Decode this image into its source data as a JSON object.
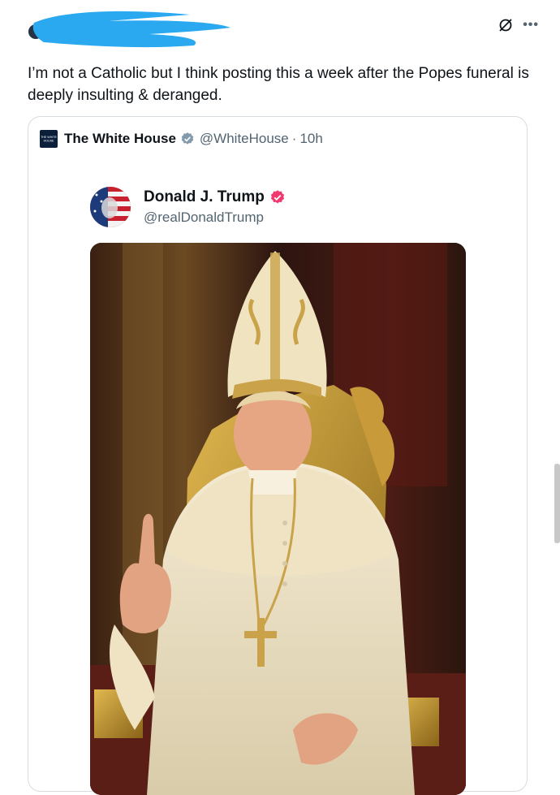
{
  "tweet": {
    "text": "I’m not a Catholic but I think posting this a week after the Popes funeral is deeply insulting & deranged.",
    "more_icon": "more-horizontal-icon",
    "grok_icon": "grok-icon"
  },
  "quote": {
    "name": "The White House",
    "handle": "@WhiteHouse",
    "separator": "·",
    "time": "10h",
    "logo_text": "THE WHITE HOUSE"
  },
  "author": {
    "name": "Donald J. Trump",
    "handle": "@realDonaldTrump"
  },
  "colors": {
    "redaction": "#2aa9f0",
    "verified_gray": "#829aab",
    "verified_pink": "#f0396f",
    "text_secondary": "#536471"
  },
  "icons": {
    "verified_gray": "verified-badge-gray-icon",
    "verified_pink": "verified-badge-pink-icon"
  }
}
